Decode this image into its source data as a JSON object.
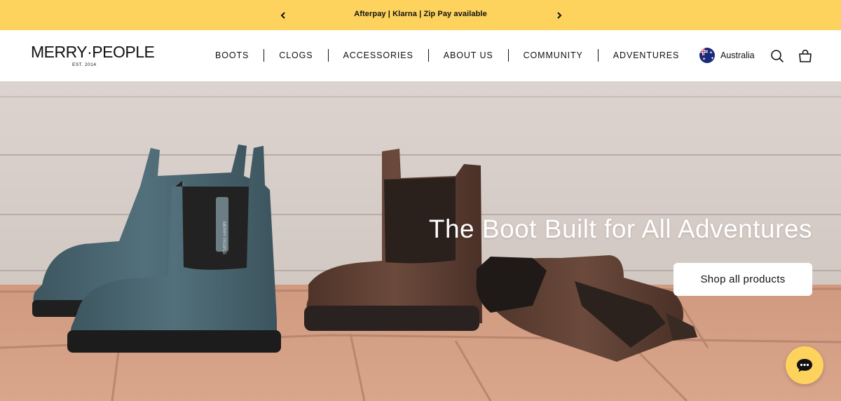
{
  "announcement": {
    "message": "Afterpay | Klarna | Zip Pay available",
    "prev_icon": "chevron-left-icon",
    "next_icon": "chevron-right-icon"
  },
  "header": {
    "logo_text": "MERRY·PEOPLE",
    "logo_sub": "EST. 2014",
    "nav": [
      "BOOTS",
      "CLOGS",
      "ACCESSORIES",
      "ABOUT US",
      "COMMUNITY",
      "ADVENTURES"
    ],
    "locale": "Australia",
    "search_icon": "search-icon",
    "cart_icon": "cart-icon"
  },
  "hero": {
    "title": "The Boot Built for All Adventures",
    "cta": "Shop all products",
    "image_label": "MERRY PEOPLE"
  },
  "chat": {
    "icon": "chat-icon"
  },
  "colors": {
    "announcement_bg": "#fdd25d",
    "text": "#111111",
    "chat_bg": "#fdd25d",
    "button_bg": "#ffffff"
  }
}
